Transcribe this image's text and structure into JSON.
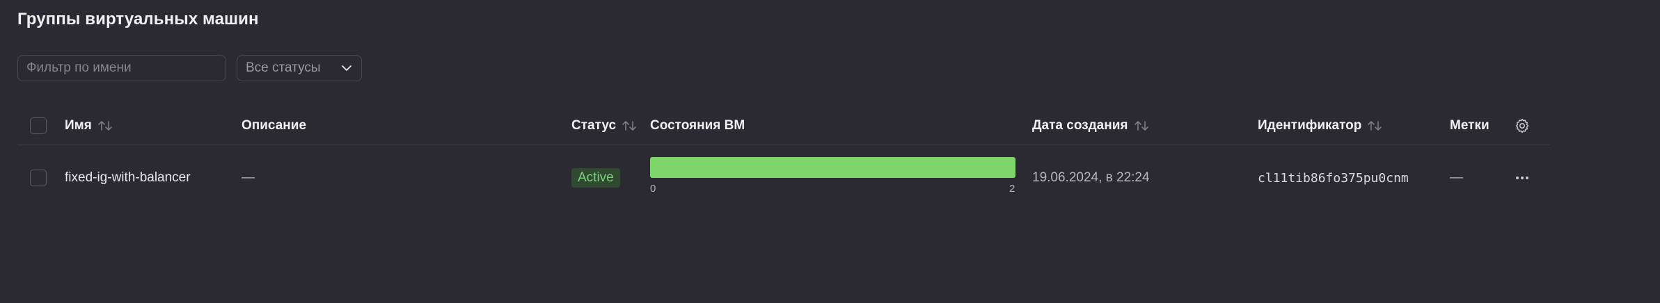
{
  "page": {
    "title": "Группы виртуальных машин"
  },
  "filters": {
    "name_placeholder": "Фильтр по имени",
    "status_select_value": "Все статусы"
  },
  "table": {
    "columns": {
      "name": "Имя",
      "description": "Описание",
      "status": "Статус",
      "vm_states": "Состояния ВМ",
      "created": "Дата создания",
      "id": "Идентификатор",
      "labels": "Метки"
    },
    "rows": [
      {
        "name": "fixed-ig-with-balancer",
        "description": "—",
        "status": "Active",
        "vm_states": {
          "min_label": "0",
          "max_label": "2",
          "running_fraction": 1.0
        },
        "created": "19.06.2024, в 22:24",
        "id": "cl11tib86fo375pu0cnm",
        "labels": "—"
      }
    ]
  },
  "colors": {
    "background": "#2b2a33",
    "status_active_bg": "#2f4a31",
    "status_active_text": "#7ed27b",
    "vm_bar_running": "#7ed56a"
  }
}
